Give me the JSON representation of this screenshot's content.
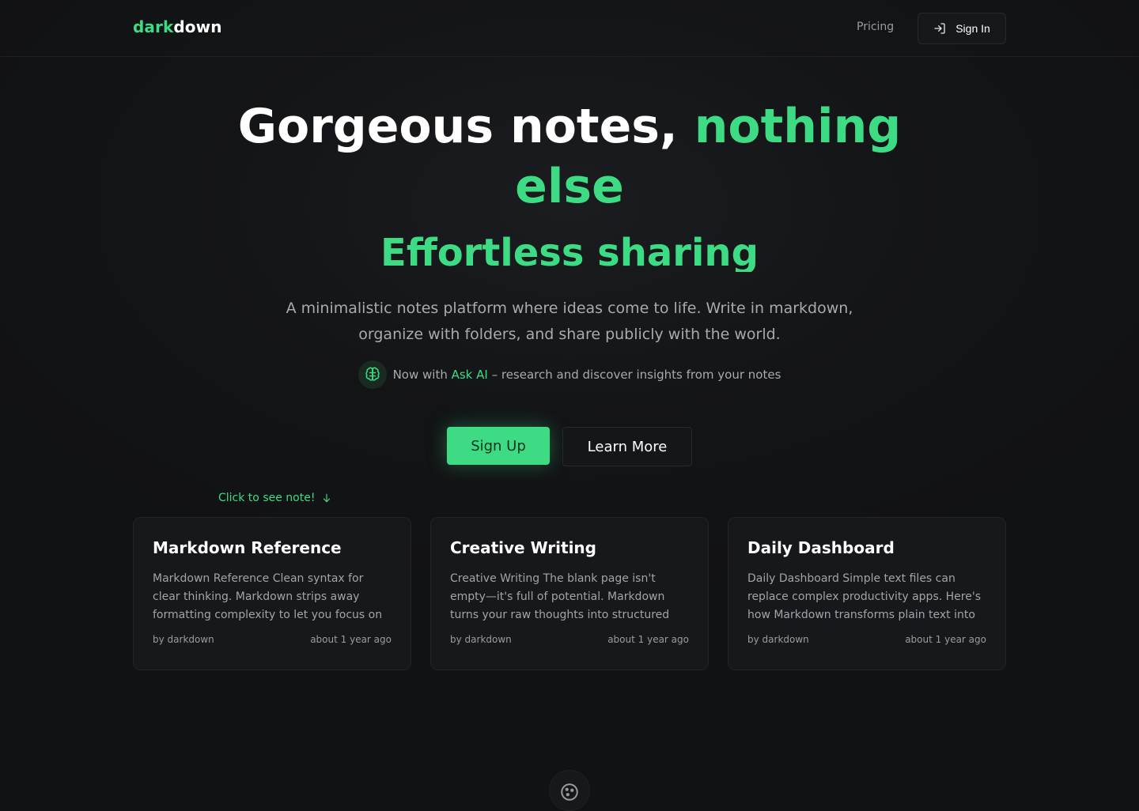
{
  "header": {
    "logo_dark": "dark",
    "logo_down": "down",
    "nav_pricing": "Pricing",
    "signin_label": "Sign In"
  },
  "hero": {
    "title_white": "Gorgeous notes, ",
    "title_green_1": "nothing",
    "title_green_2": "else",
    "subtitle": "Effortless sharing",
    "description_line1": "A minimalistic notes platform where ideas come to life. Write in markdown,",
    "description_line2": "organize with folders, and share publicly with the world.",
    "ai_prefix": "Now with ",
    "ai_highlight": "Ask AI",
    "ai_suffix": " – research and discover insights from your notes"
  },
  "buttons": {
    "signup": "Sign Up",
    "learn_more": "Learn More"
  },
  "hint": "Click to see note!",
  "cards": [
    {
      "title": "Markdown Reference",
      "excerpt": "Markdown Reference Clean syntax for clear thinking. Markdown strips away formatting complexity to let you focus on what matters...",
      "author": "by darkdown",
      "time": "about 1 year ago"
    },
    {
      "title": "Creative Writing",
      "excerpt": "Creative Writing The blank page isn't empty—it's full of potential. Markdown turns your raw thoughts into structured stories, capturing...",
      "author": "by darkdown",
      "time": "about 1 year ago"
    },
    {
      "title": "Daily Dashboard",
      "excerpt": "Daily Dashboard Simple text files can replace complex productivity apps. Here's how Markdown transforms plain text into a...",
      "author": "by darkdown",
      "time": "about 1 year ago"
    }
  ],
  "colors": {
    "accent": "#3ddc84",
    "background": "#111214",
    "card": "#17181b",
    "muted_text": "#a8aaae"
  },
  "icons": {
    "signin": "login-icon",
    "ai": "brain-icon",
    "hint": "arrow-down-icon",
    "bottom": "cookie-icon"
  }
}
